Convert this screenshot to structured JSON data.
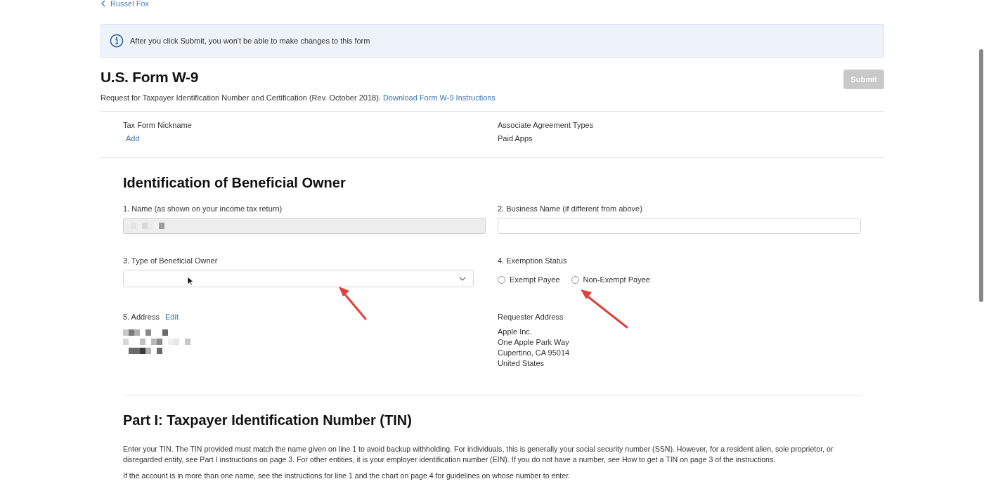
{
  "back_link": {
    "label": "Russel Fox"
  },
  "notice": {
    "text": "After you click Submit, you won't be able to make changes to this form"
  },
  "header": {
    "title": "U.S. Form W-9",
    "subtitle": "Request for Taxpayer Identification Number and Certification (Rev. October 2018).",
    "link": "Download Form W-9 Instructions",
    "submit": {
      "label": "Submit",
      "disabled": true
    }
  },
  "summary": [
    {
      "label": "Tax Form Nickname",
      "value": "Add",
      "kind": "link"
    },
    {
      "label": "Associate Agreement Types",
      "value": "Paid Apps",
      "kind": "text"
    }
  ],
  "identification": {
    "heading": "Identification of Beneficial Owner",
    "name_field": {
      "label": "1. Name (as shown on your income tax return)",
      "disabled": true
    },
    "business_field": {
      "label": "2. Business Name (if different from above)"
    },
    "owner_type": {
      "label": "3. Type of Beneficial Owner"
    },
    "exemption": {
      "label": "4. Exemption Status",
      "options": [
        {
          "label": "Exempt Payee",
          "selected": false
        },
        {
          "label": "Non-Exempt Payee",
          "selected": false
        }
      ]
    },
    "address": {
      "label": "5. Address",
      "edit": "Edit"
    },
    "requester": {
      "label": "Requester Address",
      "lines": [
        "Apple Inc.",
        "One Apple Park Way",
        "Cupertino, CA 95014",
        "United States"
      ]
    }
  },
  "tin": {
    "heading": "Part I: Taxpayer Identification Number (TIN)",
    "paragraphs": [
      "Enter your TIN. The TIN provided must match the name given on line 1 to avoid backup withholding. For individuals, this is generally your social security number (SSN). However, for a resident alien, sole proprietor, or disregarded entity, see Part I instructions on page 3. For other entities, it is your employer identification number (EIN). If you do not have a number, see How to get a TIN on page 3 of the instructions.",
      "If the account is in more than one name, see the instructions for line 1 and the chart on page 4 for guidelines on whose number to enter."
    ]
  }
}
